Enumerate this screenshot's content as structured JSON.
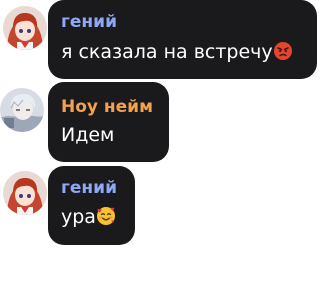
{
  "colors": {
    "bubble_bg": "#1a1a1c",
    "author_blue": "#8fa8f5",
    "author_orange": "#f3a04f",
    "message_text": "#ffffff"
  },
  "messages": [
    {
      "author": "гений",
      "author_color": "#8fa8f5",
      "text": "я сказала на встречу",
      "emoji": "angry-face-icon",
      "avatar": "anime-girl-avatar"
    },
    {
      "author": "Ноу нейм",
      "author_color": "#f3a04f",
      "text": "Идем",
      "emoji": "",
      "avatar": "anime-boy-avatar"
    },
    {
      "author": "гений",
      "author_color": "#8fa8f5",
      "text": "ура",
      "emoji": "smiling-face-with-hearts-icon",
      "avatar": "anime-girl-avatar"
    }
  ]
}
